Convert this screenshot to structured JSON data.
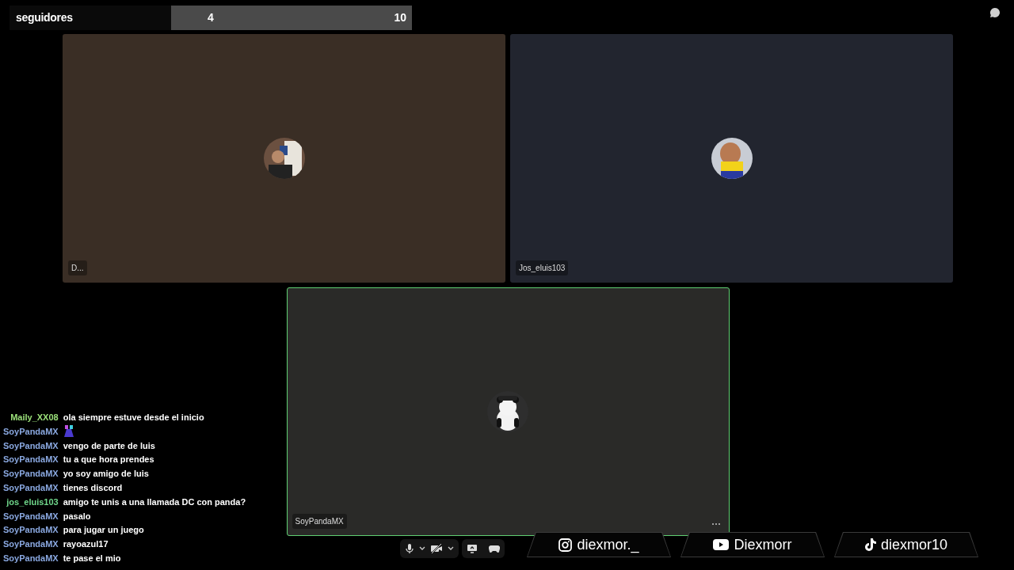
{
  "goal_bar": {
    "label": "seguidores",
    "current": "4",
    "target": "10"
  },
  "tiles": [
    {
      "name": "D...",
      "speaking": false,
      "color": "#3a2e25"
    },
    {
      "name": "Jos_eluis103",
      "speaking": false,
      "color": "#22252f"
    },
    {
      "name": "SoyPandaMX",
      "speaking": true,
      "color": "#2a2a28",
      "more_label": "⋯"
    }
  ],
  "chat": [
    {
      "user": "Maily_XX08",
      "color": "#9be07a",
      "kind": "text",
      "text": "ola siempre estuve desde el inicio"
    },
    {
      "user": "SoyPandaMX",
      "color": "#8aa8e0",
      "kind": "emote"
    },
    {
      "user": "SoyPandaMX",
      "color": "#8aa8e0",
      "kind": "text",
      "text": "vengo de parte de luis"
    },
    {
      "user": "SoyPandaMX",
      "color": "#8aa8e0",
      "kind": "text",
      "text": "tu a que hora prendes"
    },
    {
      "user": "SoyPandaMX",
      "color": "#8aa8e0",
      "kind": "text",
      "text": "yo soy amigo de luis"
    },
    {
      "user": "SoyPandaMX",
      "color": "#8aa8e0",
      "kind": "text",
      "text": "tienes discord"
    },
    {
      "user": "jos_eluis103",
      "color": "#6fd68a",
      "kind": "text",
      "text": "amigo te unis a una llamada DC con panda?"
    },
    {
      "user": "SoyPandaMX",
      "color": "#8aa8e0",
      "kind": "text",
      "text": "pasalo"
    },
    {
      "user": "SoyPandaMX",
      "color": "#8aa8e0",
      "kind": "text",
      "text": "para jugar un juego"
    },
    {
      "user": "SoyPandaMX",
      "color": "#8aa8e0",
      "kind": "text",
      "text": "rayoazul17"
    },
    {
      "user": "SoyPandaMX",
      "color": "#8aa8e0",
      "kind": "text",
      "text": "te pase el mio"
    }
  ],
  "socials": [
    {
      "kind": "instagram",
      "handle": "diexmor._"
    },
    {
      "kind": "youtube",
      "handle": "Diexmorr"
    },
    {
      "kind": "tiktok",
      "handle": "diexmor10"
    }
  ]
}
